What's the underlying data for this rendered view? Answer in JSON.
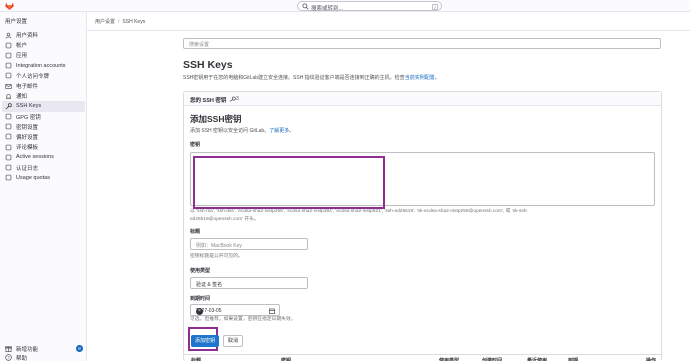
{
  "topbar": {
    "search_placeholder": "搜索或转到...",
    "search_shortcut": "/"
  },
  "sidebar": {
    "title": "用户设置",
    "items": [
      {
        "label": "用户资料",
        "icon": "user-icon",
        "active": false
      },
      {
        "label": "帐户",
        "icon": "account-icon",
        "active": false
      },
      {
        "label": "应用",
        "icon": "applications-icon",
        "active": false
      },
      {
        "label": "Integration accounts",
        "icon": "integration-icon",
        "active": false
      },
      {
        "label": "个人访问令牌",
        "icon": "token-icon",
        "active": false
      },
      {
        "label": "电子邮件",
        "icon": "mail-icon",
        "active": false
      },
      {
        "label": "通知",
        "icon": "bell-icon",
        "active": false
      },
      {
        "label": "SSH Keys",
        "icon": "key-icon",
        "active": true
      },
      {
        "label": "GPG 密钥",
        "icon": "gpg-key-icon",
        "active": false
      },
      {
        "label": "密钥设置",
        "icon": "key-settings-icon",
        "active": false
      },
      {
        "label": "偏好设置",
        "icon": "preferences-icon",
        "active": false
      },
      {
        "label": "评论模板",
        "icon": "comment-template-icon",
        "active": false
      },
      {
        "label": "Active sessions",
        "icon": "sessions-icon",
        "active": false
      },
      {
        "label": "认证日志",
        "icon": "log-icon",
        "active": false
      },
      {
        "label": "Usage quotas",
        "icon": "quota-icon",
        "active": false
      }
    ],
    "bottom": {
      "new_features": "新增功能",
      "new_features_count": "8",
      "help": "帮助"
    }
  },
  "breadcrumb": {
    "parent": "用户设置",
    "current": "SSH Keys"
  },
  "search_settings": {
    "placeholder": "搜索设置"
  },
  "page": {
    "title": "SSH Keys",
    "description": "SSH密钥用于在您的电脑和GitLab建立安全连接。SSH 指纹验证客户端是否连接到正确的主机。检查",
    "description_link": "当前实例配置",
    "description_end": "。"
  },
  "card": {
    "title": "您的 SSH 密钥",
    "count": "3"
  },
  "form": {
    "title": "添加SSH密钥",
    "subtitle": "添加 SSH 密钥以安全访问 GitLab。",
    "subtitle_link": "了解更多",
    "subtitle_end": "。",
    "key_label": "密钥",
    "key_help_line1": "以 'ssh-rsa', 'ssh-dss', 'ecdsa-sha2-nistp256', 'ecdsa-sha2-nistp384', 'ecdsa-sha2-nistp521', 'ssh-ed25519', 'sk-ecdsa-sha2-nistp256@openssh.com', 或 'sk-ssh-",
    "key_help_line2": "ed25519@openssh.com' 开头。",
    "title_label": "标题",
    "title_placeholder": "例如：MacBook Key",
    "title_help": "密钥标题是公开可见的。",
    "usage_label": "使用类型",
    "usage_value": "验证 & 签名",
    "expiry_label": "到期时间",
    "expiry_value": "2027-03-05",
    "expiry_help": "可选，但推荐。如果设置，密钥在指定日期失效。",
    "add_button": "添加密钥",
    "cancel_button": "取消"
  },
  "table": {
    "headers": [
      "标题",
      "密钥",
      "使用类型",
      "创建时间",
      "最近使用",
      "到期",
      "操作"
    ]
  },
  "colors": {
    "primary": "#1f75cb",
    "annotation": "#8e2e8e",
    "active_bg": "#e9e8f0"
  }
}
